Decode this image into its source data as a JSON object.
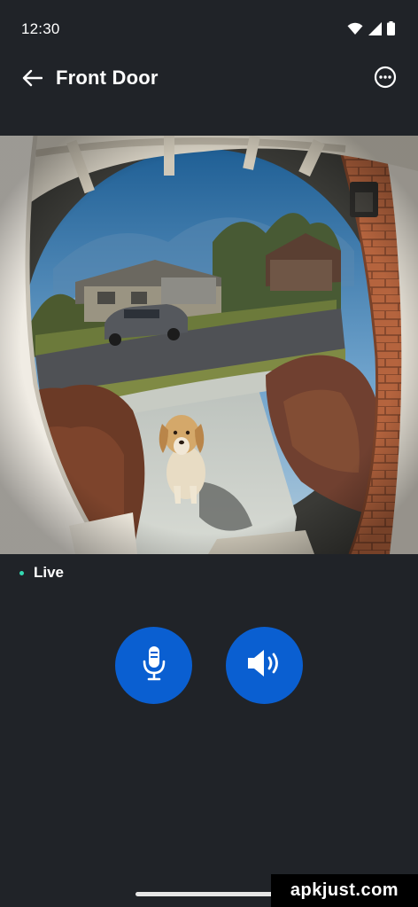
{
  "status_bar": {
    "time": "12:30",
    "icons": [
      "wifi-icon",
      "cell-signal-icon",
      "battery-icon"
    ]
  },
  "header": {
    "title": "Front Door",
    "back_icon": "arrow-left-icon",
    "menu_icon": "more-horizontal-circle-icon"
  },
  "stream": {
    "status_label": "Live",
    "status_color": "#33d9b2"
  },
  "controls": [
    {
      "name": "talk",
      "icon": "microphone-icon"
    },
    {
      "name": "audio",
      "icon": "speaker-icon"
    }
  ],
  "colors": {
    "background": "#202328",
    "accent": "#0a5fd1"
  },
  "watermark": "apkjust.com"
}
